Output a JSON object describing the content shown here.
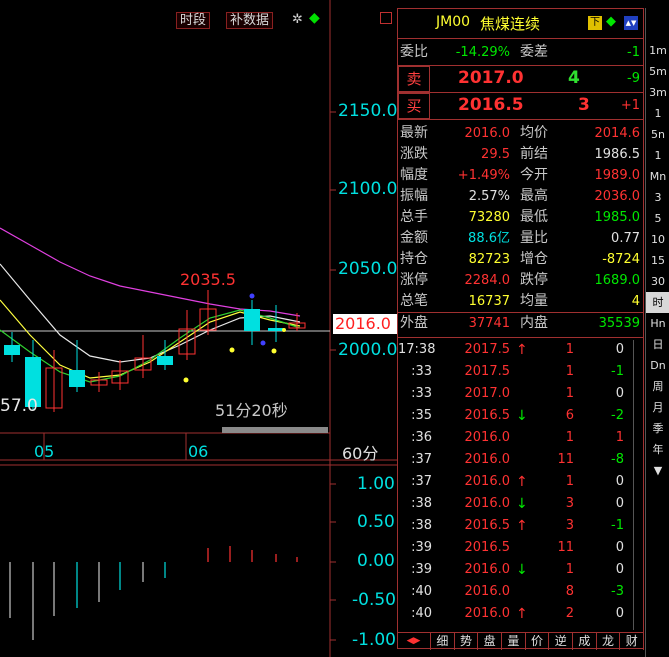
{
  "toolbar": {
    "period_btn": "时段",
    "supplement_btn": "补数据"
  },
  "chart": {
    "y_ticks": [
      "2150.0",
      "2100.0",
      "2050.0",
      "2000.0"
    ],
    "x_ticks": [
      "05",
      "06"
    ],
    "timeframe": "60分",
    "high_label": "2035.5",
    "low_label_left": "57.0",
    "current_price_tag": "2016.0",
    "countdown": "51分20秒"
  },
  "sub_chart": {
    "y_ticks": [
      "1.00",
      "0.50",
      "0.00",
      "-0.50",
      "-1.00"
    ]
  },
  "quote": {
    "code": "JM00",
    "name": "焦煤连续",
    "weibi_label": "委比",
    "weibi_value": "-14.29%",
    "weicha_label": "委差",
    "weicha_value": "-1",
    "sell_label": "卖",
    "sell_price": "2017.0",
    "sell_vol": "4",
    "sell_change": "-9",
    "buy_label": "买",
    "buy_price": "2016.5",
    "buy_vol": "3",
    "buy_change": "+1",
    "stats": [
      {
        "l1": "最新",
        "v1": "2016.0",
        "c1": "red",
        "l2": "均价",
        "v2": "2014.6",
        "c2": "red"
      },
      {
        "l1": "涨跌",
        "v1": "29.5",
        "c1": "red",
        "l2": "前结",
        "v2": "1986.5",
        "c2": "white"
      },
      {
        "l1": "幅度",
        "v1": "+1.49%",
        "c1": "red",
        "l2": "今开",
        "v2": "1989.0",
        "c2": "red"
      },
      {
        "l1": "振幅",
        "v1": "2.57%",
        "c1": "white",
        "l2": "最高",
        "v2": "2036.0",
        "c2": "red"
      },
      {
        "l1": "总手",
        "v1": "73280",
        "c1": "yellow",
        "l2": "最低",
        "v2": "1985.0",
        "c2": "green"
      },
      {
        "l1": "金额",
        "v1": "88.6亿",
        "c1": "cyan",
        "l2": "量比",
        "v2": "0.77",
        "c2": "white"
      },
      {
        "l1": "持仓",
        "v1": "82723",
        "c1": "yellow",
        "l2": "增仓",
        "v2": "-8724",
        "c2": "yellow"
      },
      {
        "l1": "涨停",
        "v1": "2284.0",
        "c1": "red",
        "l2": "跌停",
        "v2": "1689.0",
        "c2": "green"
      },
      {
        "l1": "总笔",
        "v1": "16737",
        "c1": "yellow",
        "l2": "均量",
        "v2": "4",
        "c2": "yellow"
      }
    ],
    "waipan_label": "外盘",
    "waipan_value": "37741",
    "neipan_label": "内盘",
    "neipan_value": "35539",
    "ticks": [
      {
        "t": "17:38",
        "p": "2017.5",
        "pc": "red",
        "dir": "up",
        "v": "1",
        "chg": "0",
        "cc": "white"
      },
      {
        "t": ":33",
        "p": "2017.5",
        "pc": "red",
        "dir": "",
        "v": "1",
        "chg": "-1",
        "cc": "green"
      },
      {
        "t": ":33",
        "p": "2017.0",
        "pc": "red",
        "dir": "",
        "v": "1",
        "chg": "0",
        "cc": "white"
      },
      {
        "t": ":35",
        "p": "2016.5",
        "pc": "red",
        "dir": "down",
        "v": "6",
        "chg": "-2",
        "cc": "green"
      },
      {
        "t": ":36",
        "p": "2016.0",
        "pc": "red",
        "dir": "",
        "v": "1",
        "chg": "1",
        "cc": "red"
      },
      {
        "t": ":37",
        "p": "2016.0",
        "pc": "red",
        "dir": "",
        "v": "11",
        "chg": "-8",
        "cc": "green"
      },
      {
        "t": ":37",
        "p": "2016.0",
        "pc": "red",
        "dir": "up",
        "v": "1",
        "chg": "0",
        "cc": "white"
      },
      {
        "t": ":38",
        "p": "2016.0",
        "pc": "red",
        "dir": "down",
        "v": "3",
        "chg": "0",
        "cc": "white"
      },
      {
        "t": ":38",
        "p": "2016.5",
        "pc": "red",
        "dir": "up",
        "v": "3",
        "chg": "-1",
        "cc": "green"
      },
      {
        "t": ":39",
        "p": "2016.5",
        "pc": "red",
        "dir": "",
        "v": "11",
        "chg": "0",
        "cc": "white"
      },
      {
        "t": ":39",
        "p": "2016.0",
        "pc": "red",
        "dir": "down",
        "v": "1",
        "chg": "0",
        "cc": "white"
      },
      {
        "t": ":40",
        "p": "2016.0",
        "pc": "red",
        "dir": "",
        "v": "8",
        "chg": "-3",
        "cc": "green"
      },
      {
        "t": ":40",
        "p": "2016.0",
        "pc": "red",
        "dir": "up",
        "v": "2",
        "chg": "0",
        "cc": "white"
      }
    ],
    "header_icons": [
      "下",
      "◆",
      "▲▼"
    ]
  },
  "side_items": [
    "1m",
    "5m",
    "3m",
    "1",
    "5n",
    "1",
    "Mn",
    "3",
    "5",
    "10",
    "15",
    "30",
    "时",
    "Hn",
    "日",
    "Dn",
    "周",
    "月",
    "季",
    "年",
    "▼"
  ],
  "side_active_index": 12,
  "bottom_tabs": [
    "◀▶",
    "细",
    "势",
    "盘",
    "量",
    "价",
    "逆",
    "成",
    "龙",
    "财"
  ]
}
